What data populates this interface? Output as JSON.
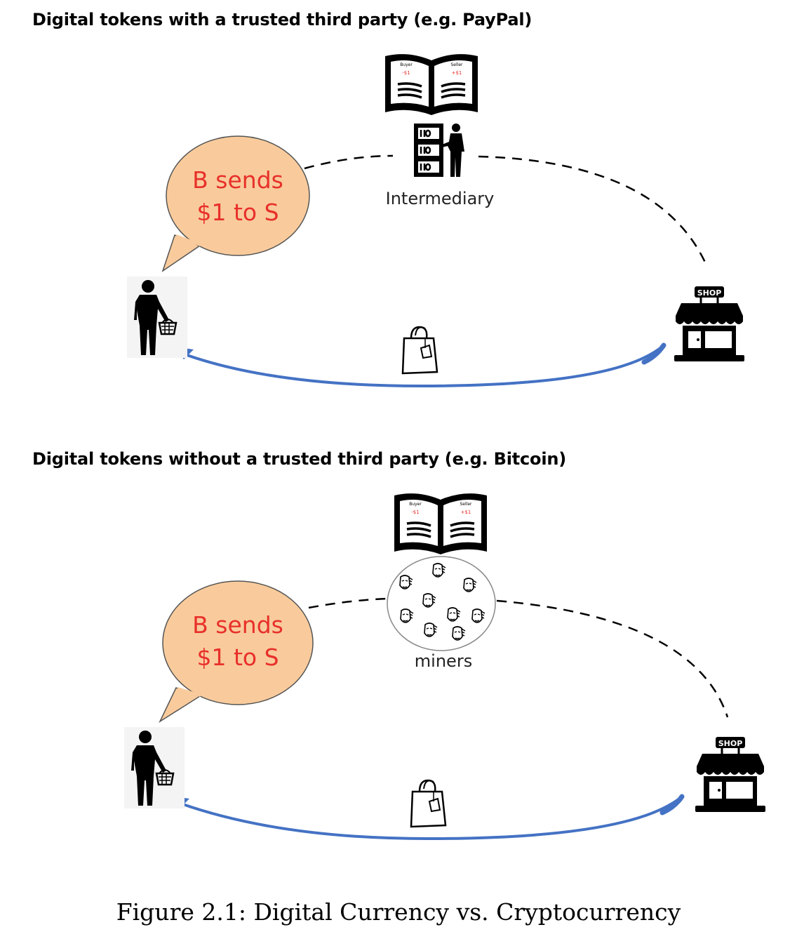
{
  "panels": [
    {
      "title": "Digital tokens with a trusted third party (e.g. PayPal)",
      "bubble": {
        "line1": "B sends",
        "line2": "$1 to S"
      },
      "ledger": {
        "left_header": "Buyer",
        "left_value": "-$1",
        "right_header": "Seller",
        "right_value": "+$1"
      },
      "intermediary_label": "Intermediary",
      "shop_sign": "SHOP"
    },
    {
      "title": "Digital tokens without a trusted third party (e.g. Bitcoin)",
      "bubble": {
        "line1": "B sends",
        "line2": "$1 to S"
      },
      "ledger": {
        "left_header": "Buyer",
        "left_value": "-$1",
        "right_header": "Seller",
        "right_value": "+$1"
      },
      "intermediary_label": "miners",
      "shop_sign": "SHOP"
    }
  ],
  "caption": "Figure 2.1: Digital Currency vs. Cryptocurrency",
  "colors": {
    "bubble_fill": "#f9cb9c",
    "bubble_text": "#e8302a",
    "arrow": "#4472c4"
  },
  "icons": [
    "ledger-book-icon",
    "server-person-icon",
    "miners-crowd-icon",
    "buyer-with-basket-icon",
    "shop-icon",
    "shopping-bag-icon"
  ]
}
